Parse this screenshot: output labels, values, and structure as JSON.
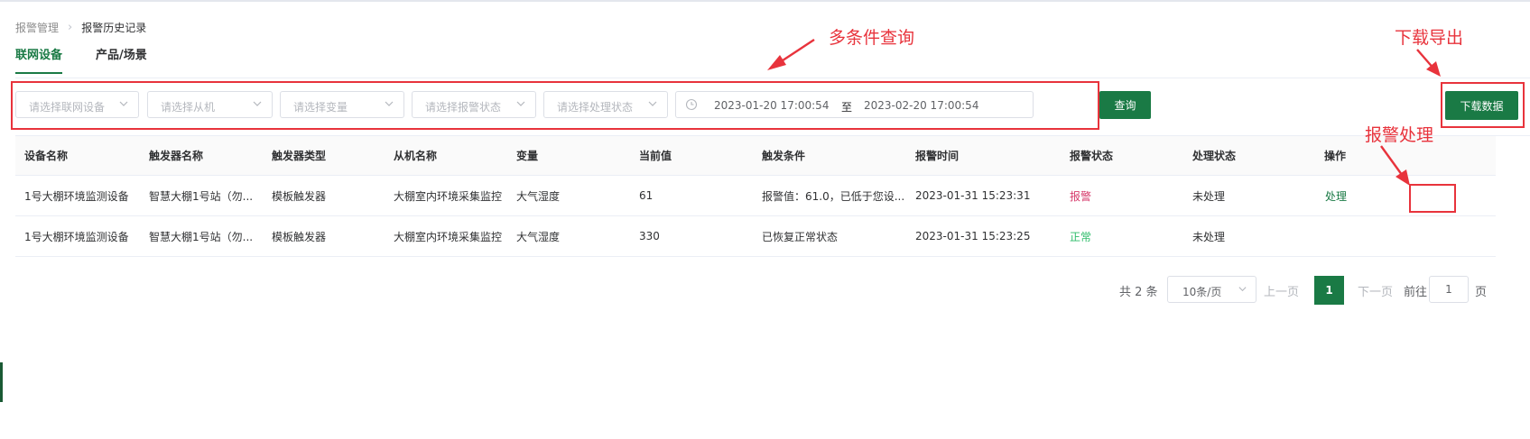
{
  "breadcrumb": {
    "parent": "报警管理",
    "current": "报警历史记录"
  },
  "tabs": [
    {
      "label": "联网设备",
      "active": true
    },
    {
      "label": "产品/场景",
      "active": false
    }
  ],
  "filters": {
    "device_placeholder": "请选择联网设备",
    "slave_placeholder": "请选择从机",
    "variable_placeholder": "请选择变量",
    "alarm_status_placeholder": "请选择报警状态",
    "handle_status_placeholder": "请选择处理状态",
    "date_start": "2023-01-20 17:00:54",
    "date_separator": "至",
    "date_end": "2023-02-20 17:00:54",
    "query_label": "查询",
    "download_label": "下载数据"
  },
  "table": {
    "headers": [
      "设备名称",
      "触发器名称",
      "触发器类型",
      "从机名称",
      "变量",
      "当前值",
      "触发条件",
      "报警时间",
      "报警状态",
      "处理状态",
      "操作"
    ],
    "rows": [
      {
        "device": "1号大棚环境监测设备",
        "trigger_name": "智慧大棚1号站（勿...",
        "trigger_type": "模板触发器",
        "slave": "大棚室内环境采集监控",
        "variable": "大气湿度",
        "value": "61",
        "condition": "报警值：61.0，已低于您设...",
        "time": "2023-01-31 15:23:31",
        "alarm_status": "报警",
        "handle_status": "未处理",
        "action": "处理"
      },
      {
        "device": "1号大棚环境监测设备",
        "trigger_name": "智慧大棚1号站（勿...",
        "trigger_type": "模板触发器",
        "slave": "大棚室内环境采集监控",
        "variable": "大气湿度",
        "value": "330",
        "condition": "已恢复正常状态",
        "time": "2023-01-31 15:23:25",
        "alarm_status": "正常",
        "handle_status": "未处理",
        "action": ""
      }
    ]
  },
  "pagination": {
    "total": "共 2 条",
    "page_size": "10条/页",
    "prev": "上一页",
    "current": "1",
    "next": "下一页",
    "goto_label": "前往",
    "goto_value": "1",
    "page_suffix": "页"
  },
  "annotations": {
    "multi_query": "多条件查询",
    "download_export": "下载导出",
    "alarm_handle": "报警处理",
    "color": "#e8333c"
  },
  "colors": {
    "primary": "#1a7a45",
    "alarm": "#d63a6b",
    "normal": "#2ebc6a"
  }
}
